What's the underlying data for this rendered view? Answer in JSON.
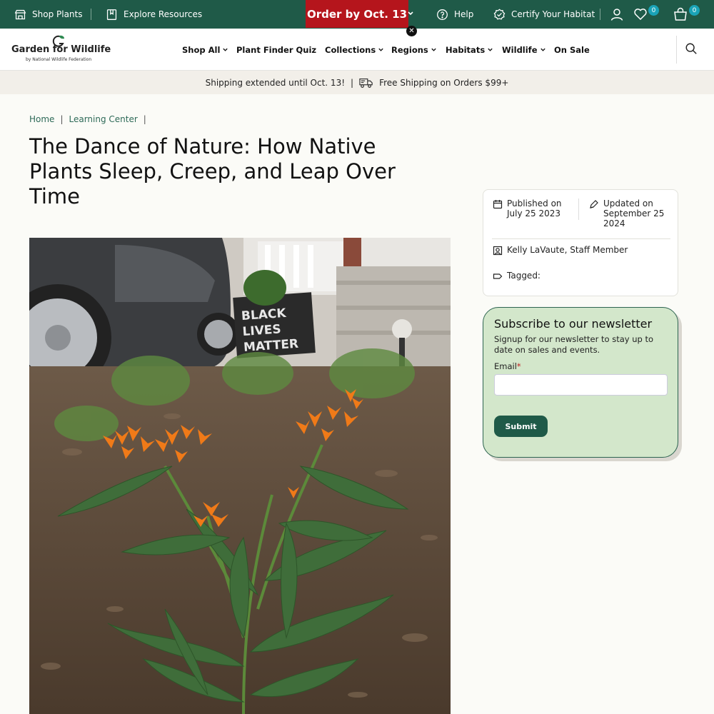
{
  "topbar": {
    "shop_plants": "Shop Plants",
    "explore_resources": "Explore Resources",
    "order_promo": "Order by Oct. 13",
    "help": "Help",
    "certify": "Certify Your Habitat",
    "wishlist_count": "0",
    "cart_count": "0"
  },
  "logo": {
    "name": "Garden for Wildlife",
    "sub": "by National Wildlife Federation"
  },
  "nav": [
    {
      "label": "Shop All"
    },
    {
      "label": "Plant Finder Quiz"
    },
    {
      "label": "Collections"
    },
    {
      "label": "Regions"
    },
    {
      "label": "Habitats"
    },
    {
      "label": "Wildlife"
    },
    {
      "label": "On Sale"
    }
  ],
  "shipping": {
    "extended": "Shipping extended until Oct. 13!",
    "separator": "|",
    "free": "Free Shipping on Orders $99+"
  },
  "breadcrumb": {
    "home": "Home",
    "learning_center": "Learning Center",
    "sep": "|"
  },
  "article": {
    "title": "The Dance of Nature: How Native Plants Sleep, Creep, and Leap Over Time",
    "published_label": "Published on",
    "published_date": "July 25 2023",
    "updated_label": "Updated on",
    "updated_date": "September 25 2024",
    "author": "Kelly LaVaute, Staff Member",
    "tagged_label": "Tagged:"
  },
  "newsletter": {
    "title": "Subscribe to our newsletter",
    "description": "Signup for our newsletter to stay up to date on sales and events.",
    "email_label": "Email",
    "required_mark": "*",
    "email_value": "",
    "submit_label": "Submit"
  },
  "colors": {
    "brand_green": "#1f5a48",
    "promo_red": "#b5151c",
    "badge_teal": "#1aa3b7",
    "newsletter_bg": "#d3e7cb"
  }
}
